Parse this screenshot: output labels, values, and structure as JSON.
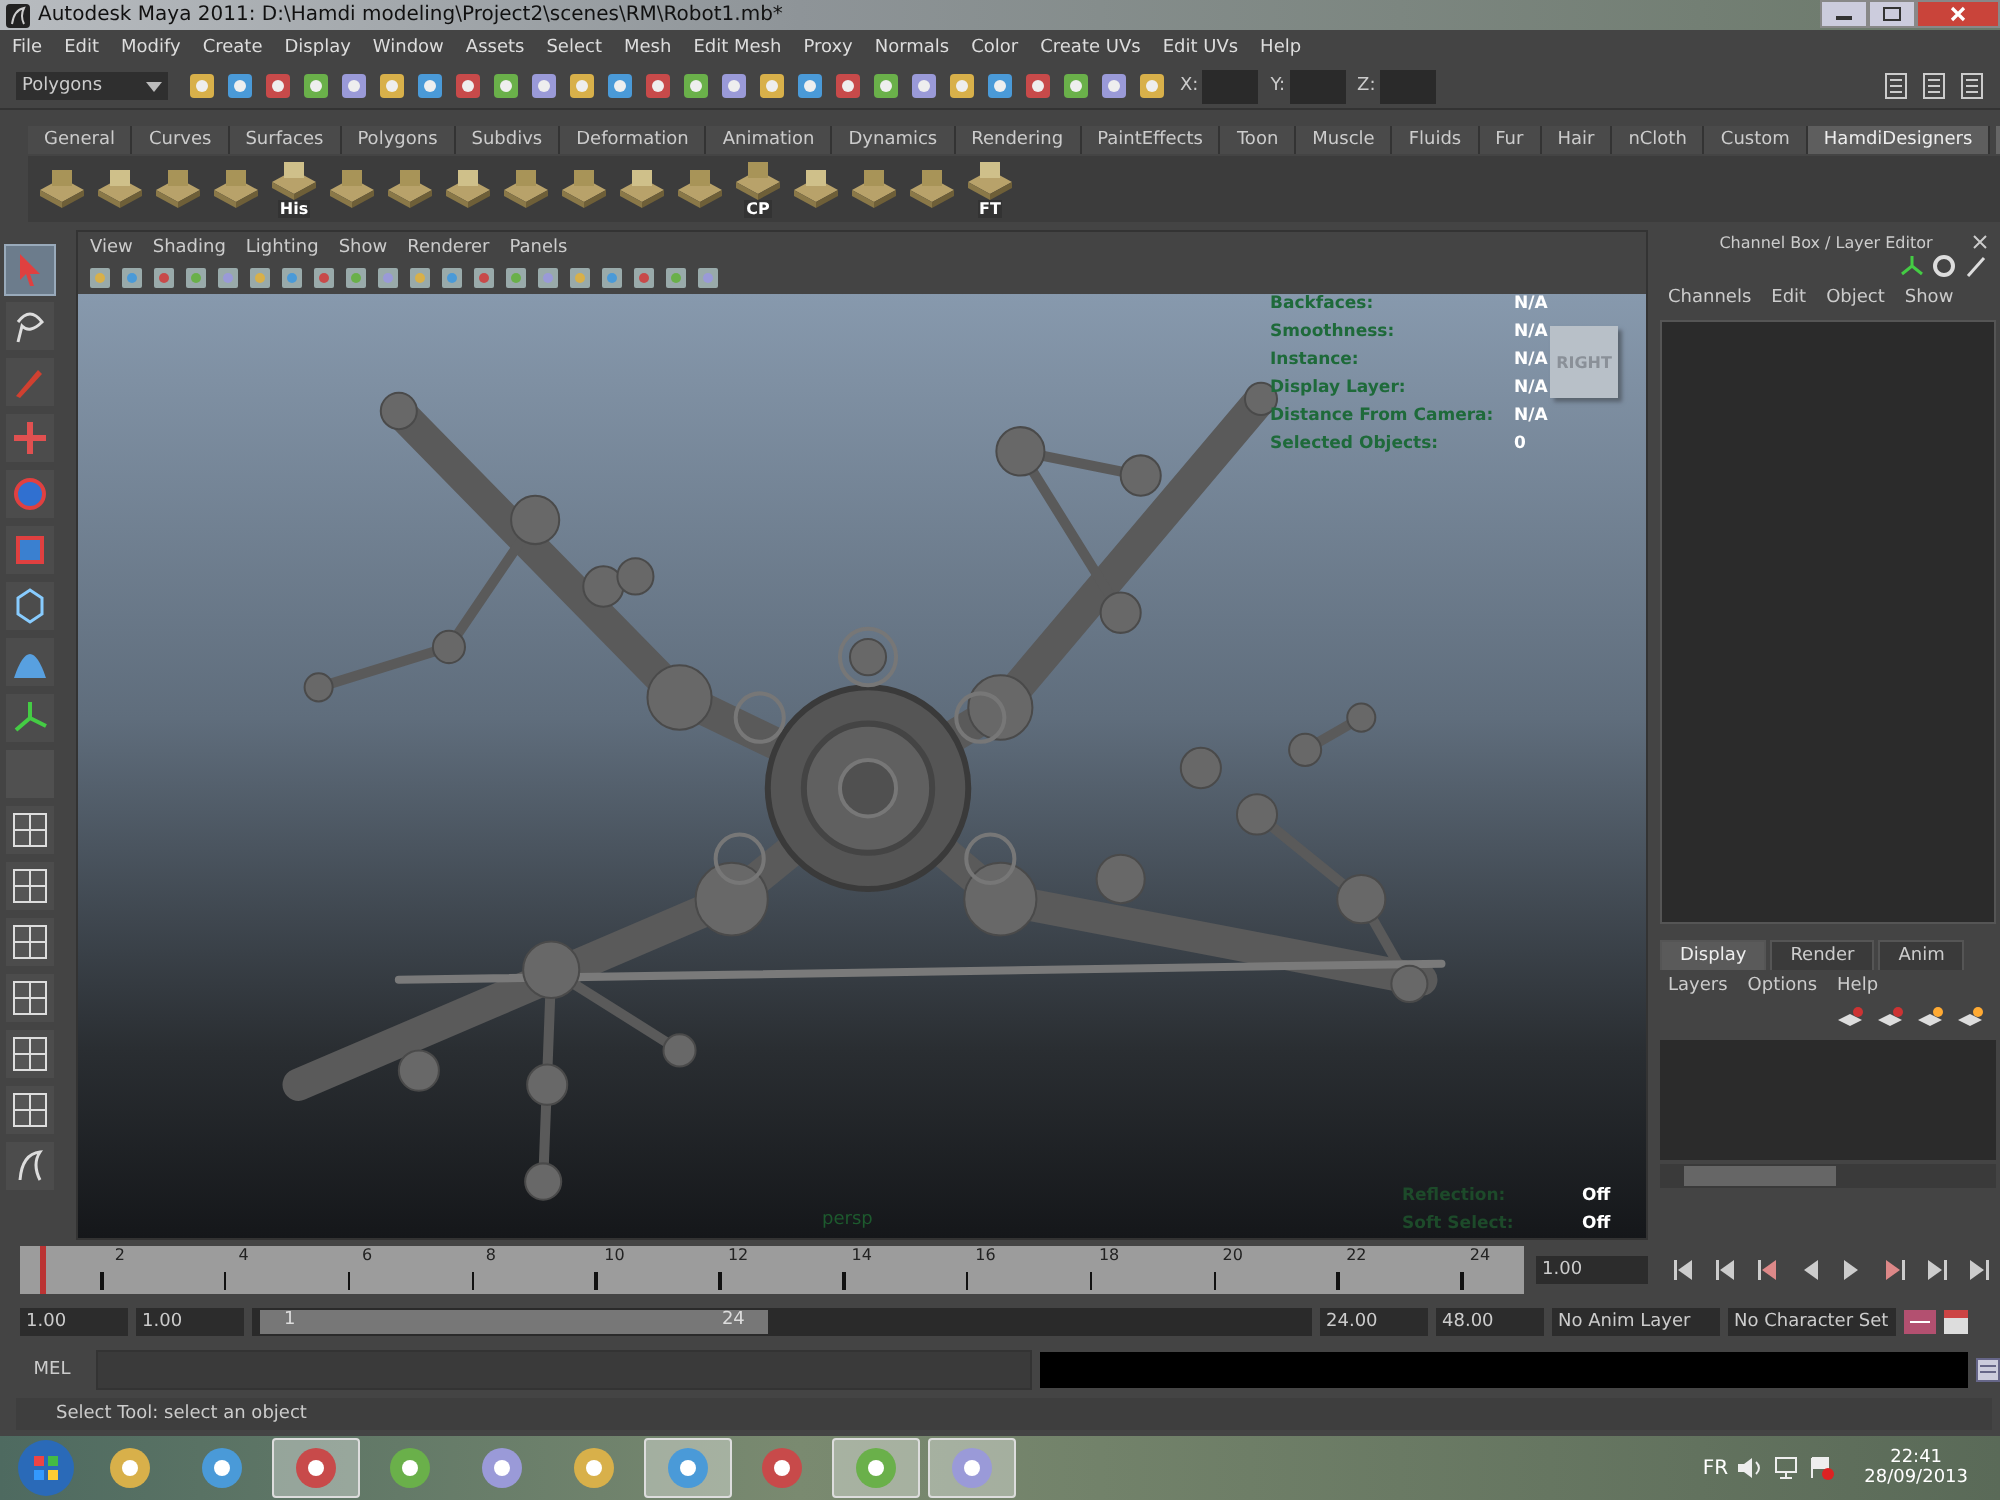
{
  "window": {
    "title": "Autodesk Maya 2011: D:\\Hamdi modeling\\Project2\\scenes\\RM\\Robot1.mb*"
  },
  "menu": [
    "File",
    "Edit",
    "Modify",
    "Create",
    "Display",
    "Window",
    "Assets",
    "Select",
    "Mesh",
    "Edit Mesh",
    "Proxy",
    "Normals",
    "Color",
    "Create UVs",
    "Edit UVs",
    "Help"
  ],
  "status_line": {
    "menu_set": "Polygons",
    "fields": [
      {
        "label": "X:"
      },
      {
        "label": "Y:"
      },
      {
        "label": "Z:"
      }
    ]
  },
  "shelf_tabs": [
    {
      "label": "General",
      "selected": false
    },
    {
      "label": "Curves",
      "selected": false
    },
    {
      "label": "Surfaces",
      "selected": false
    },
    {
      "label": "Polygons",
      "selected": false
    },
    {
      "label": "Subdivs",
      "selected": false
    },
    {
      "label": "Deformation",
      "selected": false
    },
    {
      "label": "Animation",
      "selected": false
    },
    {
      "label": "Dynamics",
      "selected": false
    },
    {
      "label": "Rendering",
      "selected": false
    },
    {
      "label": "PaintEffects",
      "selected": false
    },
    {
      "label": "Toon",
      "selected": false
    },
    {
      "label": "Muscle",
      "selected": false
    },
    {
      "label": "Fluids",
      "selected": false
    },
    {
      "label": "Fur",
      "selected": false
    },
    {
      "label": "Hair",
      "selected": false
    },
    {
      "label": "nCloth",
      "selected": false
    },
    {
      "label": "Custom",
      "selected": false
    },
    {
      "label": "HamdiDesigners",
      "selected": true
    }
  ],
  "shelf": [
    {
      "kind": "plain"
    },
    {
      "kind": "plain"
    },
    {
      "kind": "plain"
    },
    {
      "kind": "plain"
    },
    {
      "kind": "labeled",
      "label": "His"
    },
    {
      "kind": "plain"
    },
    {
      "kind": "plain"
    },
    {
      "kind": "plain"
    },
    {
      "kind": "plain"
    },
    {
      "kind": "plain"
    },
    {
      "kind": "plain"
    },
    {
      "kind": "plain"
    },
    {
      "kind": "labeled",
      "label": "CP"
    },
    {
      "kind": "plain"
    },
    {
      "kind": "plain"
    },
    {
      "kind": "plain"
    },
    {
      "kind": "labeled",
      "label": "FT"
    }
  ],
  "toolbox": [
    {
      "kind": "select",
      "selected": true
    },
    {
      "kind": "lasso",
      "selected": false
    },
    {
      "kind": "paint",
      "selected": false
    },
    {
      "kind": "move",
      "selected": false
    },
    {
      "kind": "rotate",
      "selected": false
    },
    {
      "kind": "scale",
      "selected": false
    },
    {
      "kind": "manip",
      "selected": false
    },
    {
      "kind": "soft",
      "selected": false
    },
    {
      "kind": "axes",
      "selected": false
    },
    {
      "kind": "blank",
      "selected": false
    },
    {
      "kind": "layout",
      "selected": false
    },
    {
      "kind": "layout",
      "selected": false
    },
    {
      "kind": "layout",
      "selected": false
    },
    {
      "kind": "layout",
      "selected": false
    },
    {
      "kind": "layout",
      "selected": false
    },
    {
      "kind": "layout",
      "selected": false
    },
    {
      "kind": "maya",
      "selected": false
    }
  ],
  "viewport": {
    "menu": [
      "View",
      "Shading",
      "Lighting",
      "Show",
      "Renderer",
      "Panels"
    ],
    "hud": [
      {
        "label": "Backfaces:",
        "value": "N/A"
      },
      {
        "label": "Smoothness:",
        "value": "N/A"
      },
      {
        "label": "Instance:",
        "value": "N/A"
      },
      {
        "label": "Display Layer:",
        "value": "N/A"
      },
      {
        "label": "Distance From Camera:",
        "value": "N/A"
      },
      {
        "label": "Selected Objects:",
        "value": "0"
      }
    ],
    "view_cube": "RIGHT",
    "camera": "persp",
    "hud_bottom": [
      {
        "label": "Reflection:",
        "value": "Off"
      },
      {
        "label": "Soft Select:",
        "value": "Off"
      }
    ]
  },
  "channel_box": {
    "title": "Channel Box / Layer Editor",
    "menu": [
      "Channels",
      "Edit",
      "Object",
      "Show"
    ]
  },
  "layer_editor": {
    "tabs": [
      {
        "label": "Display",
        "selected": true
      },
      {
        "label": "Render",
        "selected": false
      },
      {
        "label": "Anim",
        "selected": false
      }
    ],
    "menu": [
      "Layers",
      "Options",
      "Help"
    ]
  },
  "timeline": {
    "ticks": [
      "2",
      "4",
      "6",
      "8",
      "10",
      "12",
      "14",
      "16",
      "18",
      "20",
      "22",
      "24"
    ],
    "current": "1.00",
    "level": 0
  },
  "range": {
    "start": "1.00",
    "playback_start": "1.00",
    "slider_start": "1",
    "slider_end": "24",
    "level": 0.48,
    "playback_end": "24.00",
    "end": "48.00",
    "anim_layer": "No Anim Layer",
    "character_set": "No Character Set"
  },
  "command_line": {
    "label": "MEL"
  },
  "help_line": "Select Tool: select an object",
  "taskbar": {
    "apps": [
      {
        "selected": false
      },
      {
        "selected": false
      },
      {
        "selected": true
      },
      {
        "selected": false
      },
      {
        "selected": false
      },
      {
        "selected": false
      },
      {
        "selected": true
      },
      {
        "selected": false
      },
      {
        "selected": true
      },
      {
        "selected": true
      }
    ],
    "language": "FR",
    "time": "22:41",
    "date": "28/09/2013"
  }
}
